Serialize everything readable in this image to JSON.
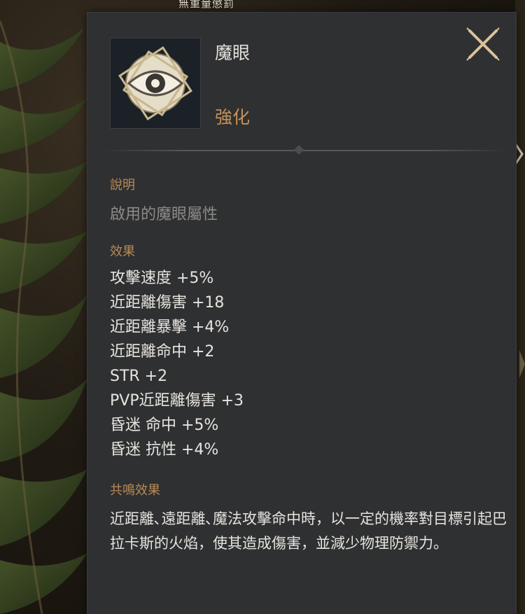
{
  "background": {
    "banner_text": "無重量懲罰"
  },
  "tooltip": {
    "item_icon": "magic-eye-icon",
    "item_name": "魔眼",
    "item_grade": "強化",
    "close_icon": "close-icon",
    "description": {
      "label": "說明",
      "text": "啟用的魔眼屬性"
    },
    "effects": {
      "label": "效果",
      "items": [
        "攻擊速度 +5%",
        "近距離傷害 +18",
        "近距離暴擊 +4%",
        "近距離命中 +2",
        "STR +2",
        "PVP近距離傷害 +3",
        "昏迷 命中 +5%",
        "昏迷 抗性 +4%"
      ]
    },
    "resonance": {
      "label": "共鳴效果",
      "text": "近距離､遠距離､魔法攻擊命中時，以一定的機率對目標引起巴拉卡斯的火焰，使其造成傷害，並減少物理防禦力。"
    }
  },
  "colors": {
    "panel_bg": "#2f3032",
    "section_label": "#b88a56",
    "grade": "#c2925a",
    "text_main": "#e6e4df",
    "text_dim": "#8c8b88"
  }
}
